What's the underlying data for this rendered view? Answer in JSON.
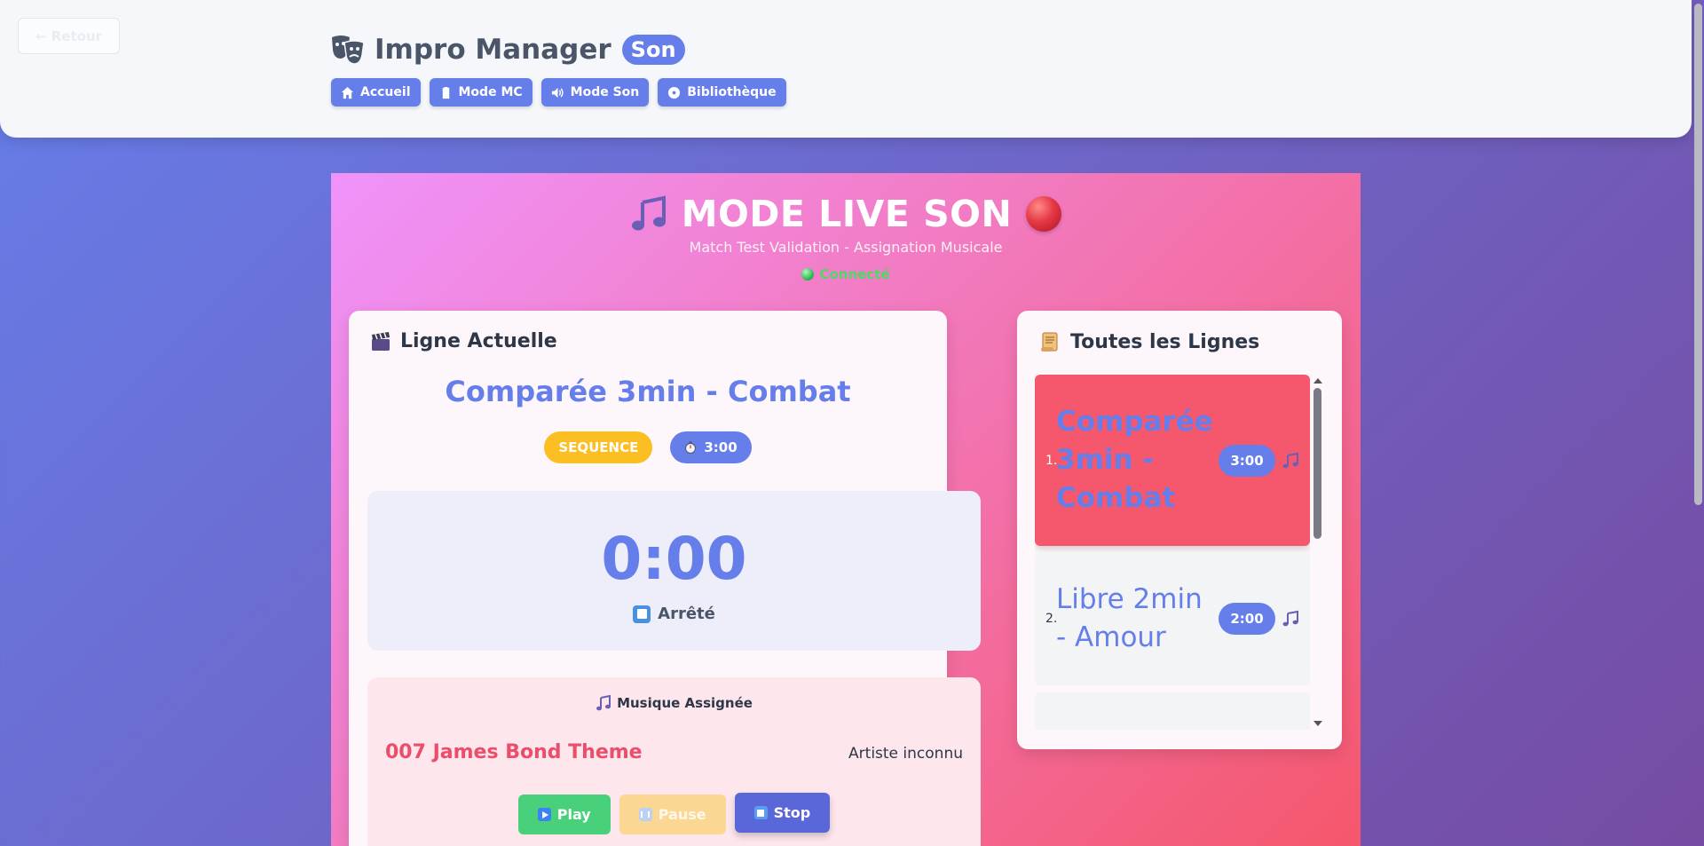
{
  "header": {
    "back_label": "← Retour",
    "app_title": "Impro Manager",
    "mode_badge": "Son",
    "nav": [
      {
        "label": "Accueil",
        "icon": "home-icon"
      },
      {
        "label": "Mode MC",
        "icon": "clipboard-icon"
      },
      {
        "label": "Mode Son",
        "icon": "speaker-icon"
      },
      {
        "label": "Bibliothèque",
        "icon": "disc-icon"
      }
    ]
  },
  "live": {
    "title": "MODE LIVE SON",
    "subtitle": "Match Test Validation - Assignation Musicale",
    "status": "Connecté",
    "status_color": "#4cd964"
  },
  "current": {
    "heading": "Ligne Actuelle",
    "line_title": "Comparée 3min - Combat",
    "type_badge": "SEQUENCE",
    "duration_badge": "3:00",
    "timer": "0:00",
    "timer_state": "Arrêté",
    "music_heading": "Musique Assignée",
    "song": "007 James Bond Theme",
    "artist": "Artiste inconnu",
    "controls": {
      "play": "Play",
      "pause": "Pause",
      "stop": "Stop"
    }
  },
  "all_lines": {
    "heading": "Toutes les Lignes",
    "items": [
      {
        "num": "1.",
        "name": "Comparée 3min - Combat",
        "duration": "3:00",
        "active": true
      },
      {
        "num": "2.",
        "name": "Libre 2min - Amour",
        "duration": "2:00",
        "active": false
      }
    ]
  },
  "colors": {
    "accent": "#667eea",
    "active_item": "#f5576c",
    "sequence_badge": "#fbbf24",
    "play": "#48d17a",
    "stop": "#5a67d8"
  }
}
